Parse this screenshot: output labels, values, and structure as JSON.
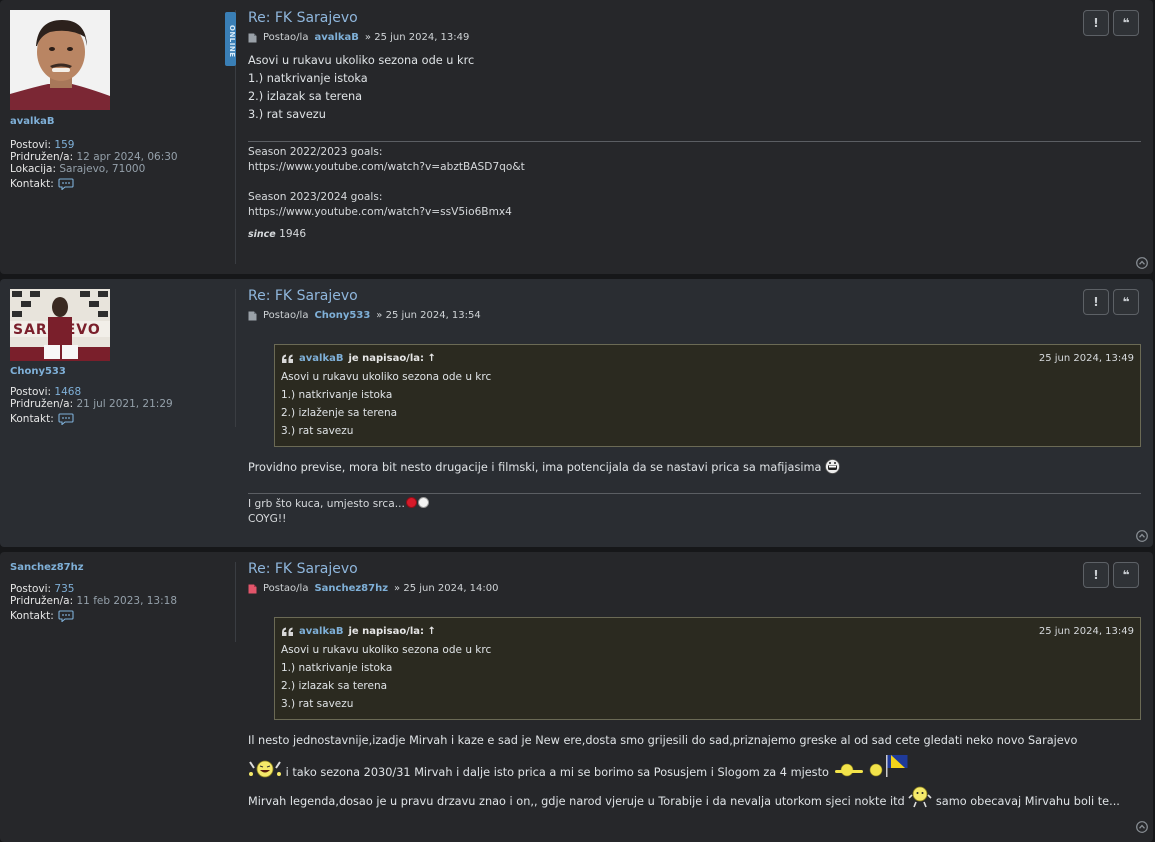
{
  "posts": [
    {
      "username": "avalkaB",
      "online_label": "ONLINE",
      "stats": [
        {
          "label": "Postovi:",
          "value": "159"
        },
        {
          "label": "Pridružen/a:",
          "value": "12 apr 2024, 06:30"
        },
        {
          "label": "Lokacija:",
          "value": "Sarajevo, 71000"
        },
        {
          "label": "Kontakt:",
          "value": ""
        }
      ],
      "title": "Re: FK Sarajevo",
      "posted_by": "Postao/la",
      "author": "avalkaB",
      "date": "» 25 jun 2024, 13:49",
      "lines": [
        "Asovi u rukavu ukoliko sezona ode u krc",
        "1.) natkrivanje istoka",
        "2.) izlazak sa terena",
        "3.) rat savezu"
      ],
      "signature": {
        "s1_label": "Season 2022/2023 goals:",
        "s1_url": "https://www.youtube.com/watch?v=abztBASD7qo&t",
        "s2_label": "Season 2023/2024 goals:",
        "s2_url": "https://www.youtube.com/watch?v=ssV5io6Bmx4",
        "since_word": "since",
        "since_year": "1946"
      }
    },
    {
      "username": "Chony533",
      "stats": [
        {
          "label": "Postovi:",
          "value": "1468"
        },
        {
          "label": "Pridružen/a:",
          "value": "21 jul 2021, 21:29"
        },
        {
          "label": "Kontakt:",
          "value": ""
        }
      ],
      "title": "Re: FK Sarajevo",
      "posted_by": "Postao/la",
      "author": "Chony533",
      "date": "» 25 jun 2024, 13:54",
      "quote": {
        "author": "avalkaB",
        "says": "je napisao/la: ↑",
        "date": "25 jun 2024, 13:49",
        "lines": [
          "Asovi u rukavu ukoliko sezona ode u krc",
          "1.) natkrivanje istoka",
          "2.) izlaženje sa terena",
          "3.) rat savezu"
        ]
      },
      "text": "Providno previse, mora bit nesto drugacije i filmski, ima potencijala da se nastavi prica sa mafijasima",
      "signature": {
        "line1": "I grb što kuca, umjesto srca...",
        "line2": "COYG!!"
      }
    },
    {
      "username": "Sanchez87hz",
      "stats": [
        {
          "label": "Postovi:",
          "value": "735"
        },
        {
          "label": "Pridružen/a:",
          "value": "11 feb 2023, 13:18"
        },
        {
          "label": "Kontakt:",
          "value": ""
        }
      ],
      "title": "Re: FK Sarajevo",
      "posted_by": "Postao/la",
      "author": "Sanchez87hz",
      "date": "» 25 jun 2024, 14:00",
      "quote": {
        "author": "avalkaB",
        "says": "je napisao/la: ↑",
        "date": "25 jun 2024, 13:49",
        "lines": [
          "Asovi u rukavu ukoliko sezona ode u krc",
          "1.) natkrivanje istoka",
          "2.) izlazak sa terena",
          "3.) rat savezu"
        ]
      },
      "text1": "Il nesto jednostavnije,izadje Mirvah i kaze e sad je New ere,dosta smo grijesili do sad,priznajemo greske al od sad cete gledati neko novo Sarajevo",
      "text2": "i tako sezona 2030/31 Mirvah i dalje isto prica a mi se borimo sa Posusjem i Slogom za 4 mjesto",
      "text3a": "Mirvah legenda,dosao je u pravu drzavu znao i on,, gdje narod vjeruje u Torabije i da nevalja utorkom sjeci nokte itd",
      "text3b": "samo obecavaj Mirvahu boli te..."
    }
  ],
  "buttons": {
    "report": "!",
    "quote": "❝"
  },
  "colors": {
    "link": "#7fb0d8",
    "title": "#8fb6dc",
    "online": "#3a7fb6",
    "quote_bg": "#2b2a20"
  }
}
